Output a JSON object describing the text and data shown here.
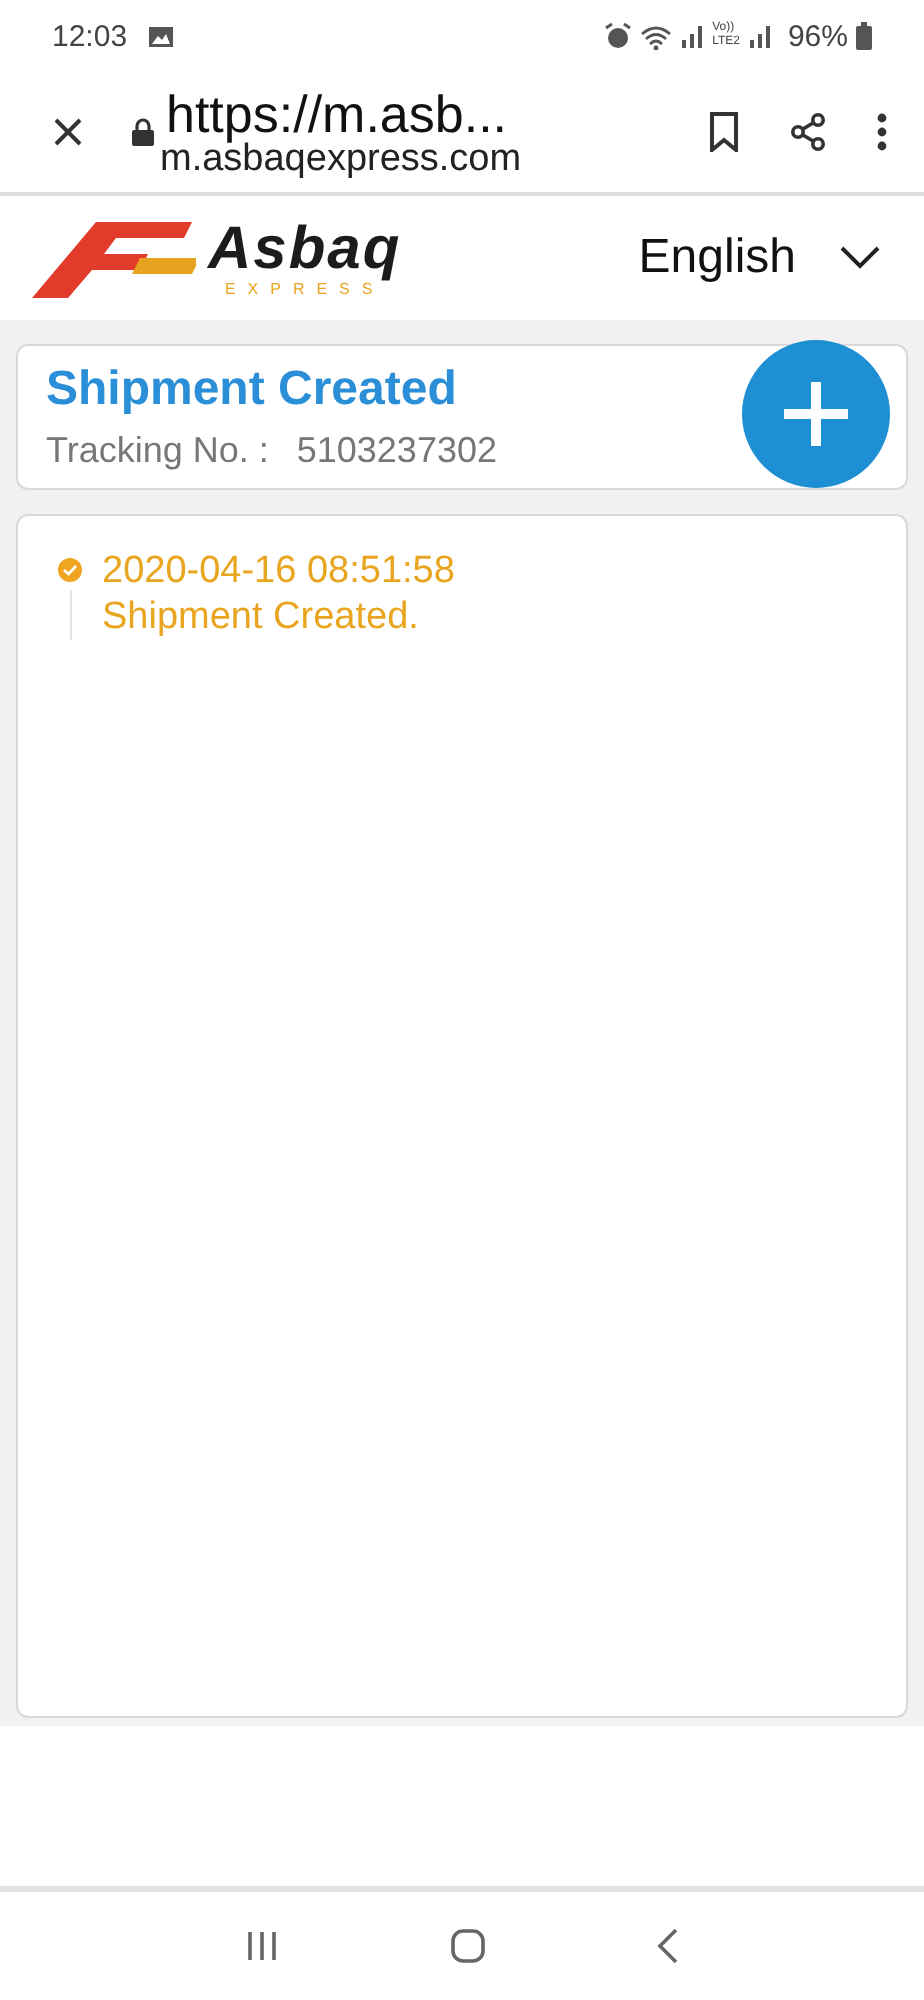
{
  "status_bar": {
    "time": "12:03",
    "volte": "Vo))",
    "lte": "LTE2",
    "battery": "96%"
  },
  "browser": {
    "title": "https://m.asb...",
    "url": "m.asbaqexpress.com"
  },
  "header": {
    "brand": "Asbaq",
    "tagline": "EXPRESS",
    "language": "English"
  },
  "shipment": {
    "status": "Shipment Created",
    "tracking_label": "Tracking No. :",
    "tracking_number": "5103237302"
  },
  "events": [
    {
      "time": "2020-04-16 08:51:58",
      "description": "Shipment Created.",
      "done": true
    }
  ]
}
